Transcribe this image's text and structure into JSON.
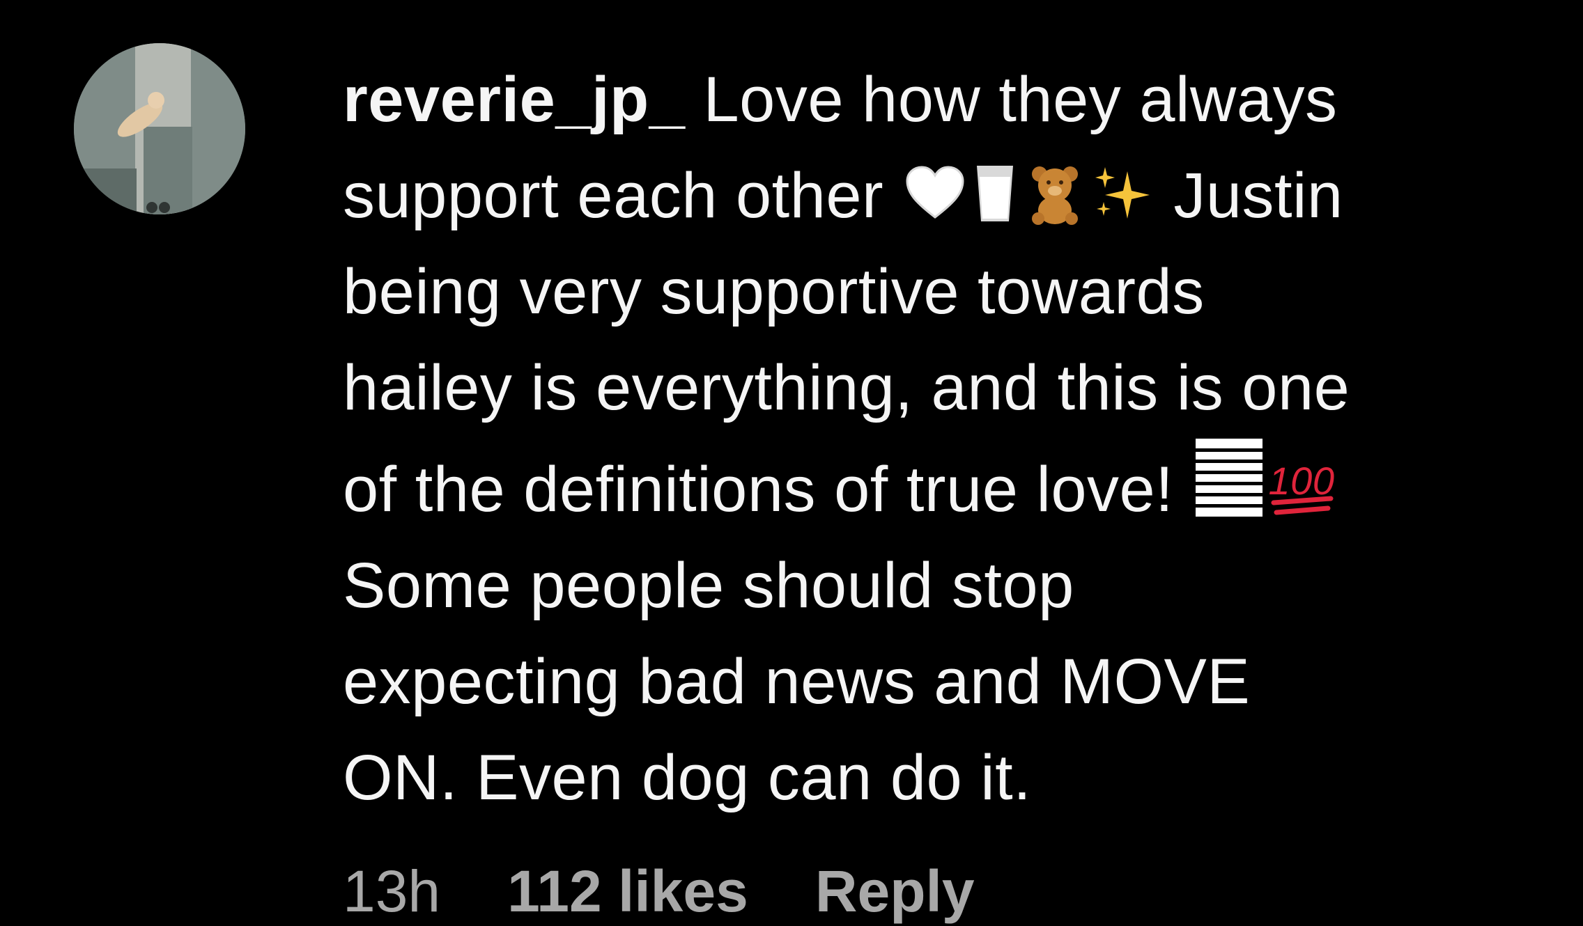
{
  "comment": {
    "avatar_icon": "user-avatar",
    "username": "reverie_jp_",
    "lines": [
      "Love how they always",
      "support each other",
      "Justin",
      "being very supportive towards",
      "hailey is everything, and this is one",
      "of the definitions of true love!",
      "Some people should stop",
      "expecting bad news and MOVE",
      "ON. Even dog can do it."
    ],
    "emojis": {
      "line2": [
        "white-heart-emoji",
        "glass-of-milk-emoji",
        "teddy-bear-emoji",
        "sparkles-emoji"
      ],
      "line5": [
        "books-stack-emoji",
        "hundred-points-emoji"
      ]
    },
    "hundred_text": "100",
    "meta": {
      "time": "13h",
      "likes": "112 likes",
      "reply": "Reply"
    },
    "colors": {
      "background": "#000000",
      "text": "#f5f5f5",
      "secondary": "#a8a8a8",
      "hundred": "#e0243b"
    }
  }
}
